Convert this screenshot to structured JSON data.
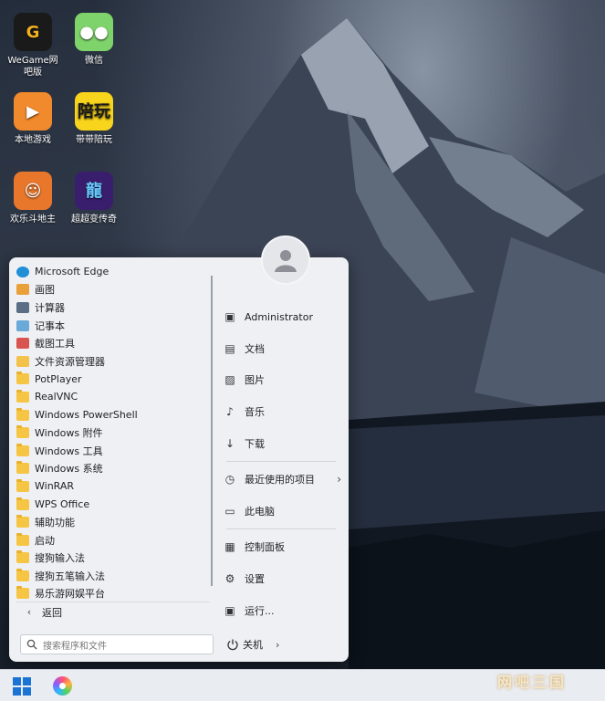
{
  "desktop_icons": [
    {
      "label": "WeGame网吧版",
      "icon": "wegame-icon",
      "color": "#1a1a1a",
      "accent": "#f2b01e",
      "glyph": "G"
    },
    {
      "label": "微信",
      "icon": "wechat-icon",
      "color": "#7ed36b",
      "accent": "#ffffff",
      "glyph": "●●"
    },
    {
      "label": "本地游戏",
      "icon": "local-games-icon",
      "color": "#f08a2c",
      "accent": "#ffffff",
      "glyph": "▶"
    },
    {
      "label": "带带陪玩",
      "icon": "daidai-icon",
      "color": "#f8d41c",
      "accent": "#1a1a1a",
      "glyph": "陪玩"
    },
    {
      "label": "欢乐斗地主",
      "icon": "doudizhu-icon",
      "color": "#e9772b",
      "accent": "#ffffff",
      "glyph": "☺"
    },
    {
      "label": "超超变传奇",
      "icon": "legend-game-icon",
      "color": "#3a1e6e",
      "accent": "#6cf",
      "glyph": "龍"
    }
  ],
  "start_menu": {
    "programs": [
      {
        "label": "Microsoft Edge",
        "icon": "edge-icon"
      },
      {
        "label": "画图",
        "icon": "paint-icon"
      },
      {
        "label": "计算器",
        "icon": "calculator-icon"
      },
      {
        "label": "记事本",
        "icon": "notepad-icon"
      },
      {
        "label": "截图工具",
        "icon": "snipping-tool-icon"
      },
      {
        "label": "文件资源管理器",
        "icon": "file-explorer-icon"
      },
      {
        "label": "PotPlayer",
        "icon": "folder-icon"
      },
      {
        "label": "RealVNC",
        "icon": "folder-icon"
      },
      {
        "label": "Windows PowerShell",
        "icon": "folder-icon"
      },
      {
        "label": "Windows 附件",
        "icon": "folder-icon"
      },
      {
        "label": "Windows 工具",
        "icon": "folder-icon"
      },
      {
        "label": "Windows 系统",
        "icon": "folder-icon"
      },
      {
        "label": "WinRAR",
        "icon": "folder-icon"
      },
      {
        "label": "WPS Office",
        "icon": "folder-icon"
      },
      {
        "label": "辅助功能",
        "icon": "folder-icon"
      },
      {
        "label": "启动",
        "icon": "folder-icon"
      },
      {
        "label": "搜狗输入法",
        "icon": "folder-icon"
      },
      {
        "label": "搜狗五笔输入法",
        "icon": "folder-icon"
      },
      {
        "label": "易乐游网娱平台",
        "icon": "folder-icon"
      }
    ],
    "back_label": "返回",
    "right_items": [
      {
        "label": "Administrator",
        "icon": "user-folder-icon",
        "glyph": "▣"
      },
      {
        "label": "文档",
        "icon": "document-icon",
        "glyph": "▤"
      },
      {
        "label": "图片",
        "icon": "pictures-icon",
        "glyph": "▨"
      },
      {
        "label": "音乐",
        "icon": "music-icon",
        "glyph": "♪"
      },
      {
        "label": "下载",
        "icon": "download-icon",
        "glyph": "↓"
      },
      {
        "label": "最近使用的项目",
        "icon": "recent-icon",
        "glyph": "◷",
        "has_arrow": true
      },
      {
        "label": "此电脑",
        "icon": "computer-icon",
        "glyph": "▭"
      },
      {
        "label": "控制面板",
        "icon": "control-panel-icon",
        "glyph": "▦"
      },
      {
        "label": "设置",
        "icon": "settings-icon",
        "glyph": "⚙"
      },
      {
        "label": "运行...",
        "icon": "run-icon",
        "glyph": "▣"
      }
    ],
    "search_placeholder": "搜索程序和文件",
    "power_label": "关机"
  },
  "taskbar": {
    "watermark": "网吧三国"
  }
}
